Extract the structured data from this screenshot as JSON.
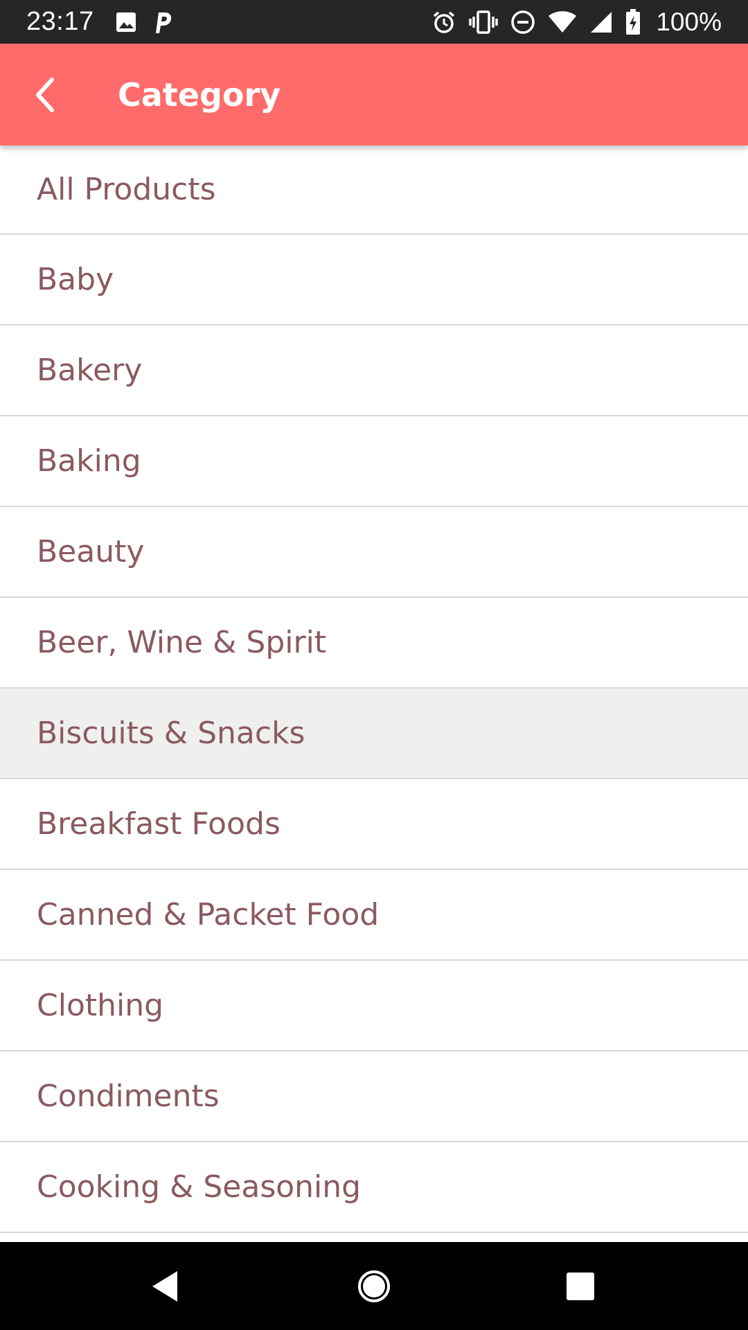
{
  "status_bar": {
    "time": "23:17",
    "battery": "100%",
    "left_icons": [
      "image-icon",
      "parking-icon"
    ],
    "right_icons": [
      "alarm-icon",
      "vibrate-icon",
      "do-not-disturb-icon",
      "wifi-icon",
      "cell-signal-icon",
      "battery-charging-icon"
    ]
  },
  "app_bar": {
    "title": "Category",
    "background": "#ff6b6b"
  },
  "categories": [
    {
      "label": "All Products"
    },
    {
      "label": "Baby"
    },
    {
      "label": "Bakery"
    },
    {
      "label": "Baking"
    },
    {
      "label": "Beauty"
    },
    {
      "label": "Beer, Wine & Spirit"
    },
    {
      "label": "Biscuits & Snacks",
      "highlighted": true
    },
    {
      "label": "Breakfast Foods"
    },
    {
      "label": "Canned & Packet Food"
    },
    {
      "label": "Clothing"
    },
    {
      "label": "Condiments"
    },
    {
      "label": "Cooking & Seasoning"
    }
  ],
  "nav_bar": {
    "buttons": [
      "back-nav-icon",
      "home-nav-icon",
      "recents-nav-icon"
    ]
  }
}
